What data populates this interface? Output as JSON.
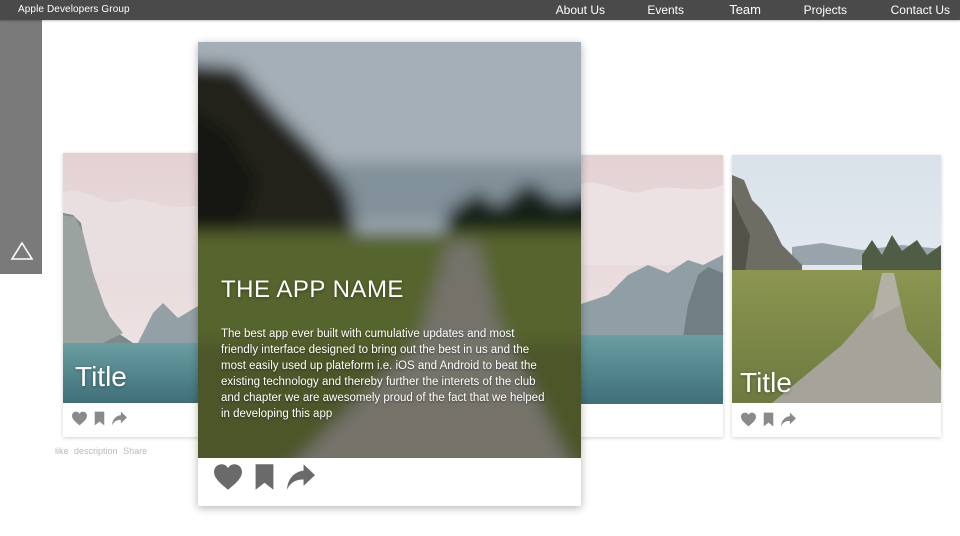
{
  "brand": "Apple Developers Group",
  "nav": [
    {
      "label": "About Us",
      "active": false
    },
    {
      "label": "Events",
      "active": false
    },
    {
      "label": "Team",
      "active": true
    },
    {
      "label": "Projects",
      "active": false
    },
    {
      "label": "Contact Us",
      "active": false
    }
  ],
  "cards": [
    {
      "title": "Title"
    },
    {
      "title": ""
    },
    {
      "title": "Title"
    }
  ],
  "featured": {
    "app_name": "THE APP NAME",
    "description": "The best app ever built with cumulative updates and most friendly interface designed to bring out the best in us and the most easily used up plateform i.e. iOS and Android to beat the existing technology and thereby further the interets of the club and chapter we  are awesomely proud of the fact that we helped in developing this app"
  },
  "hidden_labels": {
    "like": "like",
    "description": "description",
    "share": "Share"
  },
  "colors": {
    "topbar": "#4a4a4a",
    "side_panel": "#7a7a7a",
    "icon_gray": "#8a8a8a",
    "icon_dark": "#6a6a6a"
  },
  "icons": [
    "triangle-up-icon",
    "heart-icon",
    "bookmark-icon",
    "share-arrow-icon"
  ]
}
